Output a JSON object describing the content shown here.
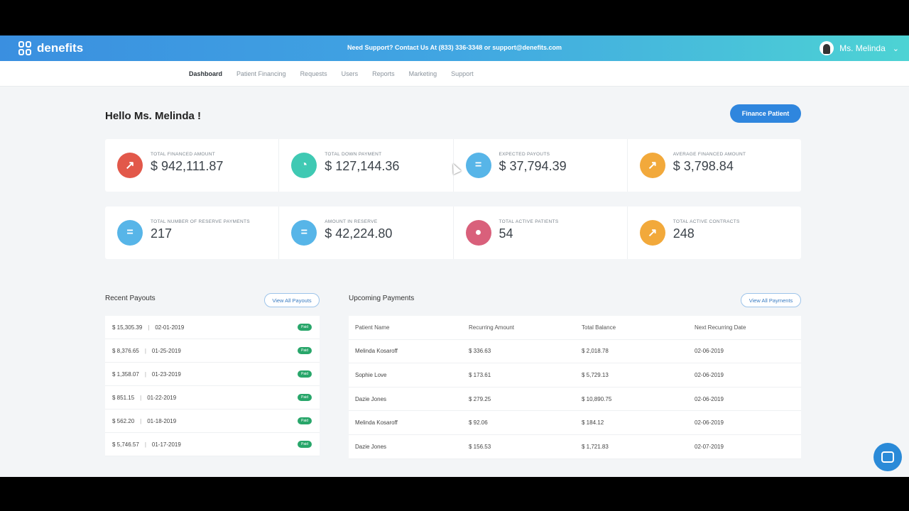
{
  "header": {
    "logo_text": "denefits",
    "support_text": "Need Support? Contact Us At (833) 336-3348 or support@denefits.com",
    "user_name": "Ms. Melinda",
    "caret": "⌄"
  },
  "nav": {
    "items": [
      "Dashboard",
      "Patient Financing",
      "Requests",
      "Users",
      "Reports",
      "Marketing",
      "Support"
    ]
  },
  "main": {
    "greeting": "Hello Ms. Melinda !",
    "finance_button": "Finance Patient"
  },
  "stats": [
    {
      "label": "Total Financed Amount",
      "value": "$ 942,111.87",
      "icon": "arrow-up-right-icon",
      "color": "#e2584a"
    },
    {
      "label": "Total Down Payment",
      "value": "$ 127,144.36",
      "icon": "gauge-icon",
      "color": "#3fc9b3"
    },
    {
      "label": "Expected Payouts",
      "value": "$ 37,794.39",
      "icon": "equals-icon",
      "color": "#57b5e8"
    },
    {
      "label": "Average Financed Amount",
      "value": "$ 3,798.84",
      "icon": "trend-icon",
      "color": "#f2a93b"
    },
    {
      "label": "Total Number of Reserve Payments",
      "value": "217",
      "icon": "equals-icon",
      "color": "#57b5e8"
    },
    {
      "label": "Amount in Reserve",
      "value": "$ 42,224.80",
      "icon": "equals-icon",
      "color": "#57b5e8"
    },
    {
      "label": "Total Active Patients",
      "value": "54",
      "icon": "person-icon",
      "color": "#d9607b"
    },
    {
      "label": "Total Active Contracts",
      "value": "248",
      "icon": "trend-icon",
      "color": "#f2a93b"
    }
  ],
  "recent_payouts": {
    "title": "Recent Payouts",
    "button": "View All Payouts",
    "badge": "Paid",
    "rows": [
      {
        "amount": "$ 15,305.39",
        "date": "02-01-2019"
      },
      {
        "amount": "$ 8,376.65",
        "date": "01-25-2019"
      },
      {
        "amount": "$ 1,358.07",
        "date": "01-23-2019"
      },
      {
        "amount": "$ 851.15",
        "date": "01-22-2019"
      },
      {
        "amount": "$ 562.20",
        "date": "01-18-2019"
      },
      {
        "amount": "$ 5,746.57",
        "date": "01-17-2019"
      }
    ]
  },
  "upcoming_payments": {
    "title": "Upcoming Payments",
    "button": "View All Payments",
    "columns": [
      "Patient Name",
      "Recurring Amount",
      "Total Balance",
      "Next Recurring Date"
    ],
    "rows": [
      [
        "Melinda Kosaroff",
        "$ 336.63",
        "$ 2,018.78",
        "02-06-2019"
      ],
      [
        "Sophie Love",
        "$ 173.61",
        "$ 5,729.13",
        "02-06-2019"
      ],
      [
        "Dazie Jones",
        "$ 279.25",
        "$ 10,890.75",
        "02-06-2019"
      ],
      [
        "Melinda Kosaroff",
        "$ 92.06",
        "$ 184.12",
        "02-06-2019"
      ],
      [
        "Dazie Jones",
        "$ 156.53",
        "$ 1,721.83",
        "02-07-2019"
      ]
    ]
  }
}
